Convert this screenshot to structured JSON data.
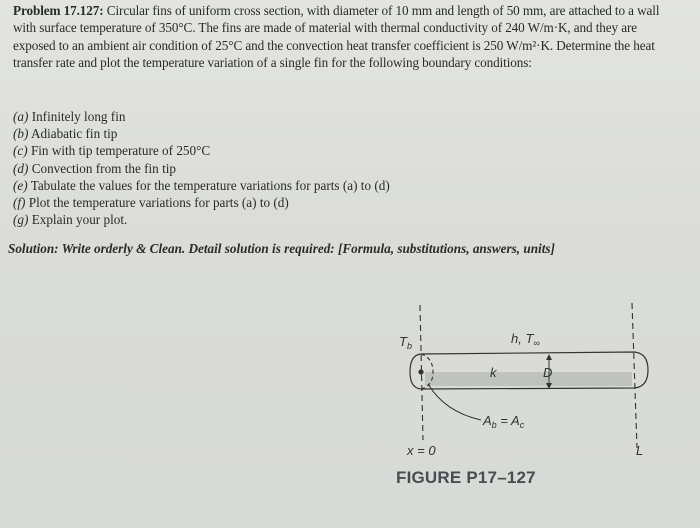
{
  "problem": {
    "label": "Problem 17.127:",
    "text": "Circular fins of uniform cross section, with diameter of 10 mm and length of 50 mm, are attached to a wall with surface temperature of 350°C. The fins are made of material with thermal conductivity of 240 W/m·K, and they are exposed to an ambient air condition of 25°C and the convection heat transfer coefficient is 250 W/m²·K. Determine the heat transfer rate and plot the temperature variation of a single fin for the following boundary conditions:"
  },
  "parts": [
    {
      "letter": "(a)",
      "text": " Infinitely long fin"
    },
    {
      "letter": "(b)",
      "text": " Adiabatic fin tip"
    },
    {
      "letter": "(c)",
      "text": " Fin with tip temperature of 250°C"
    },
    {
      "letter": "(d)",
      "text": " Convection from the fin tip"
    },
    {
      "letter": "(e)",
      "text": " Tabulate the values for the temperature variations for parts (a) to (d)"
    },
    {
      "letter": "(f)",
      "text": " Plot the temperature variations for parts (a) to (d)"
    },
    {
      "letter": "(g)",
      "text": " Explain your plot."
    }
  ],
  "solution_prompt": "Solution: Write orderly & Clean. Detail solution is required: [Formula, substitutions, answers, units]",
  "figure": {
    "caption": "FIGURE P17–127",
    "labels": {
      "base_temp": "T",
      "base_temp_sub": "b",
      "convection": "h, T",
      "convection_sub": "∞",
      "conductivity": "k",
      "diameter": "D",
      "area": "A",
      "area_sub_b": "b",
      "area_eq": " = A",
      "area_sub_c": "c",
      "x_origin": "x = 0",
      "length": "L"
    }
  }
}
